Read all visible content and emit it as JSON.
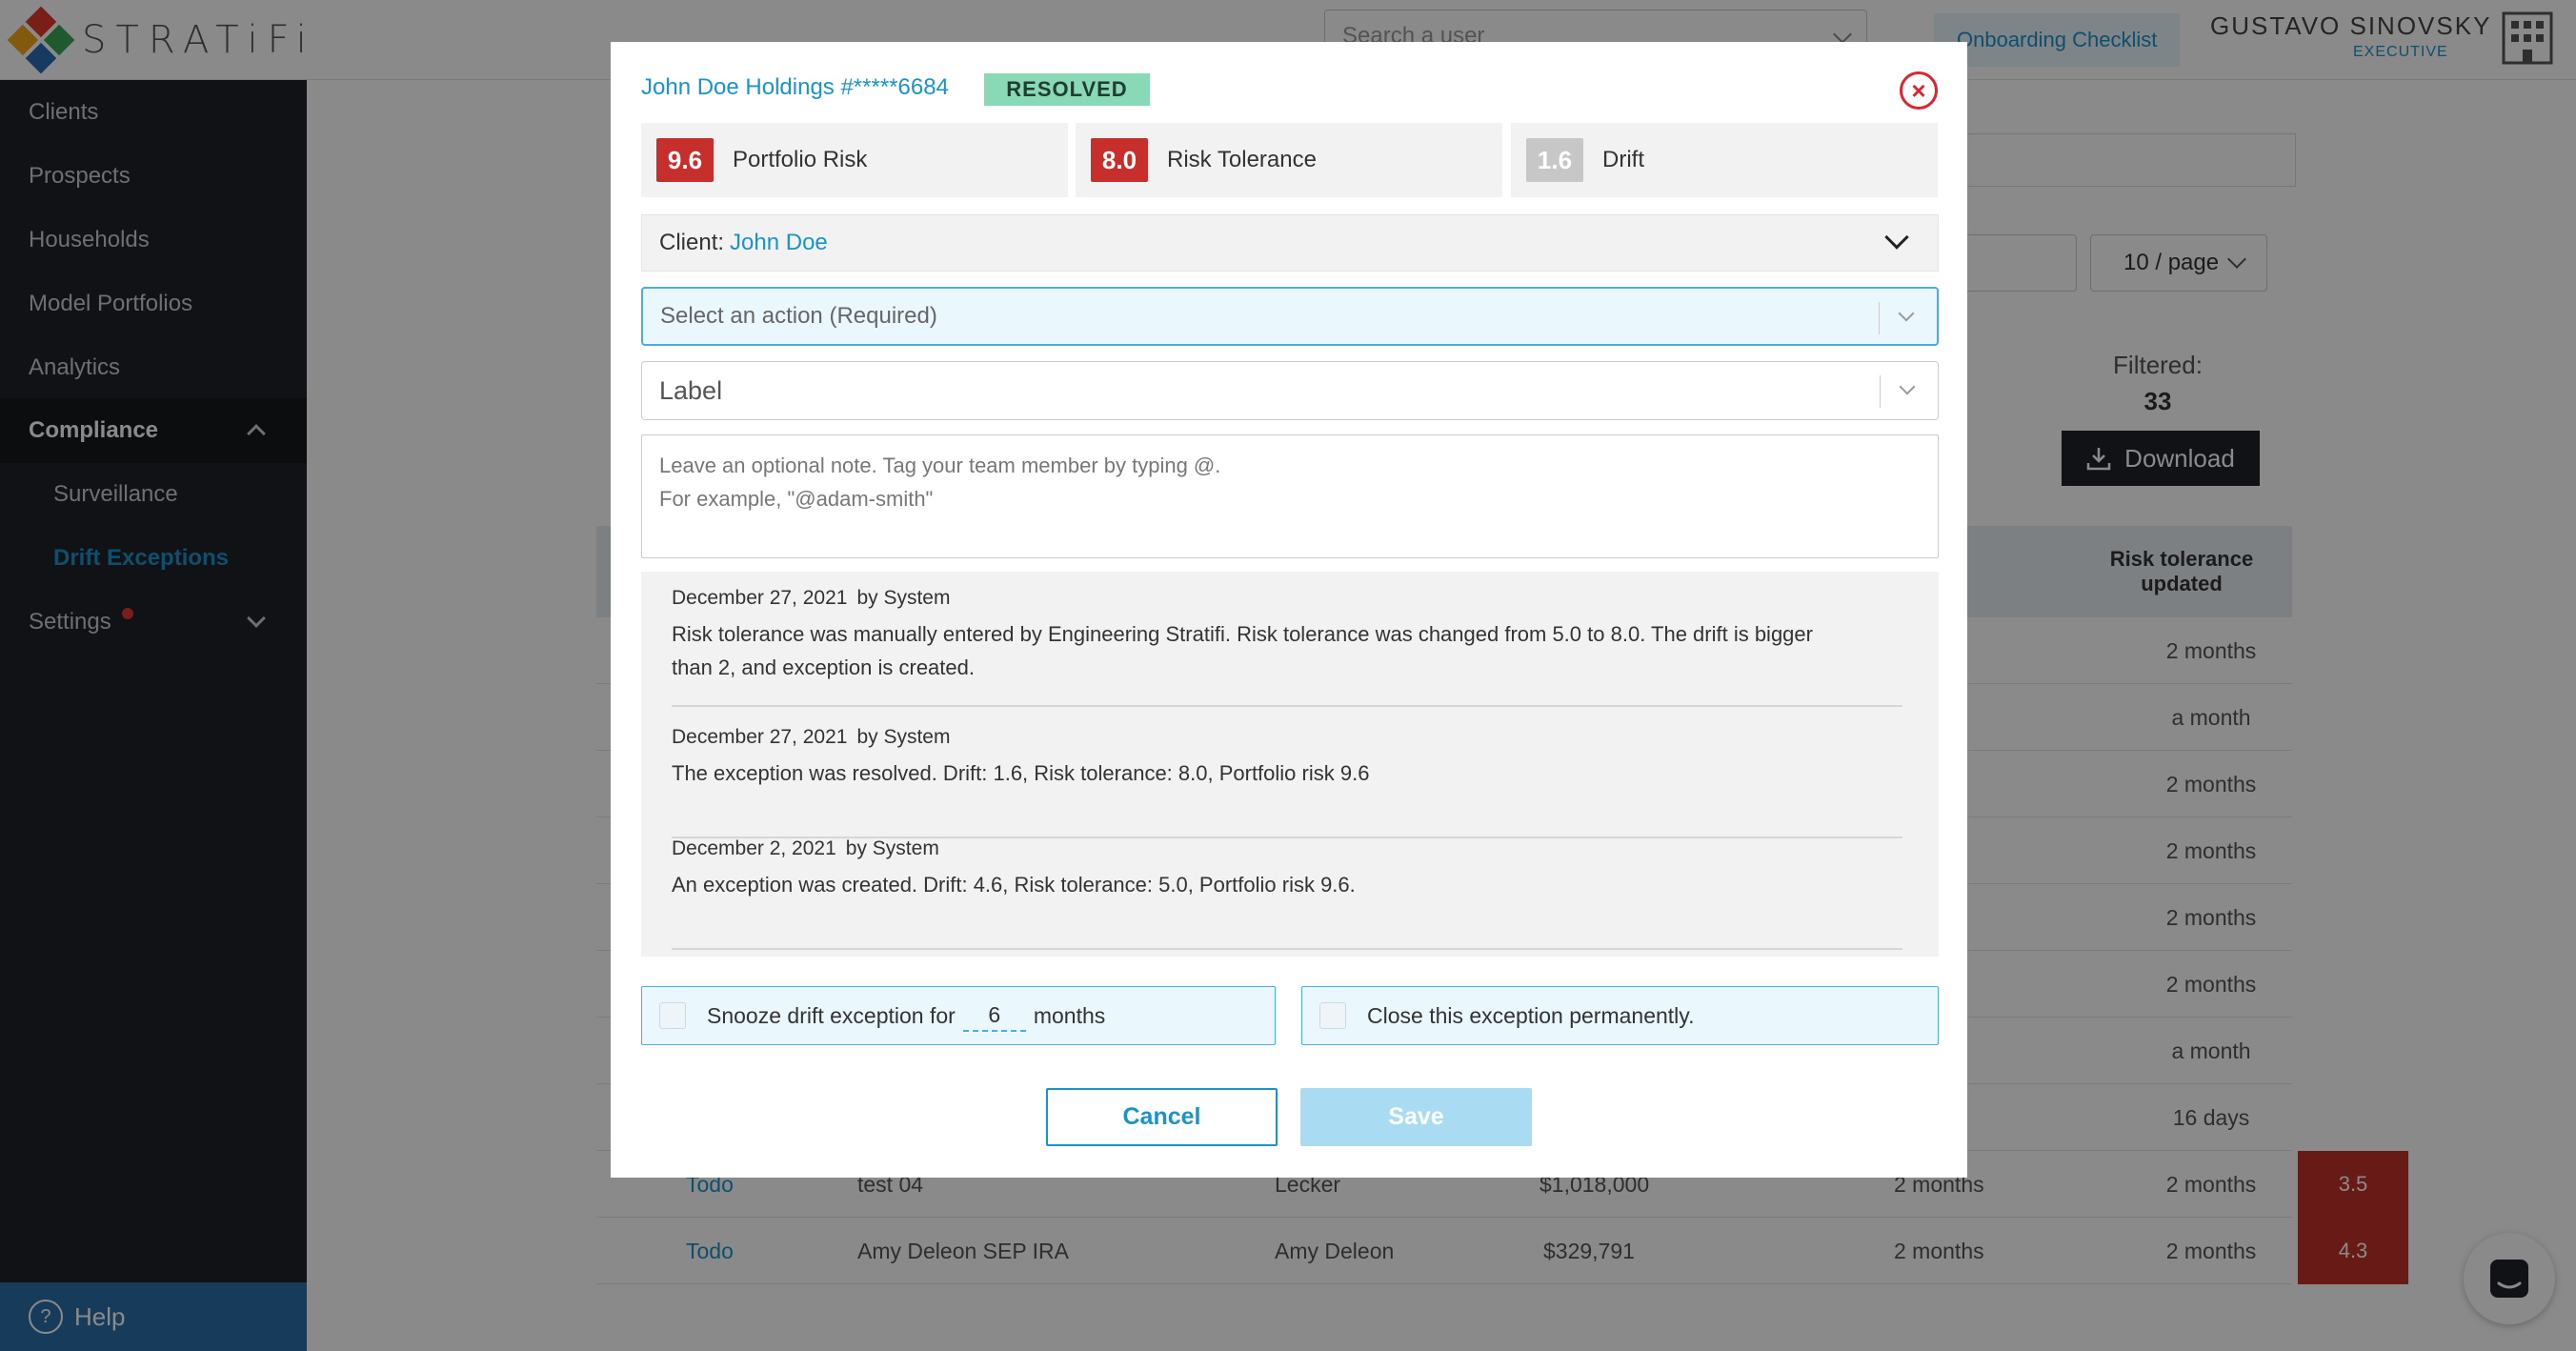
{
  "app": {
    "logo_text": "STRATiFi",
    "search_placeholder": "Search a user",
    "onboarding_label": "Onboarding Checklist",
    "user_name": "GUSTAVO SINOVSKY",
    "user_role": "EXECUTIVE"
  },
  "sidebar": {
    "items": [
      {
        "label": "Clients"
      },
      {
        "label": "Prospects"
      },
      {
        "label": "Households"
      },
      {
        "label": "Model Portfolios"
      },
      {
        "label": "Analytics"
      },
      {
        "label": "Compliance"
      },
      {
        "label": "Surveillance"
      },
      {
        "label": "Drift Exceptions"
      },
      {
        "label": "Settings"
      }
    ],
    "help_label": "Help"
  },
  "background": {
    "page_size": "10 / page",
    "filtered_label": "Filtered:",
    "filtered_count": "33",
    "download_label": "Download",
    "risk_tolerance_header": "Risk tolerance updated",
    "rows": [
      {
        "risk_updated": "2 months"
      },
      {
        "risk_updated": "a month"
      },
      {
        "risk_updated": "2 months"
      },
      {
        "risk_updated": "2 months"
      },
      {
        "risk_updated": "2 months"
      },
      {
        "risk_updated": "2 months"
      },
      {
        "risk_updated": "a month"
      },
      {
        "risk_updated": "16 days"
      },
      {
        "status": "Todo",
        "account": "test 04",
        "client": "Lecker",
        "value": "$1,018,000",
        "risk": "3.5",
        "drift_updated": "2 months",
        "risk_updated": "2 months"
      },
      {
        "status": "Todo",
        "account": "Amy Deleon SEP IRA",
        "client": "Amy Deleon",
        "value": "$329,791",
        "risk": "4.3",
        "drift_updated": "2 months",
        "risk_updated": "2 months"
      }
    ]
  },
  "modal": {
    "title": "John Doe Holdings #*****6684",
    "status": "RESOLVED",
    "metrics": [
      {
        "value": "9.6",
        "label": "Portfolio Risk",
        "color": "#c62f2c"
      },
      {
        "value": "8.0",
        "label": "Risk Tolerance",
        "color": "#c62f2c"
      },
      {
        "value": "1.6",
        "label": "Drift",
        "color": "#c7c7c7"
      }
    ],
    "client_label": "Client:",
    "client_name": "John Doe",
    "action_placeholder": "Select an action (Required)",
    "label_placeholder": "Label",
    "note_placeholder": "Leave an optional note. Tag your team member by typing @.\nFor example, \"@adam-smith\"",
    "history": [
      {
        "date": "December 27, 2021",
        "by": "by System",
        "text": "Risk tolerance was manually entered by Engineering Stratifi. Risk tolerance was changed from 5.0 to 8.0. The drift is bigger than 2, and exception is created."
      },
      {
        "date": "December 27, 2021",
        "by": "by System",
        "text": "The exception was resolved. Drift: 1.6, Risk tolerance: 8.0, Portfolio risk 9.6"
      },
      {
        "date": "December 2, 2021",
        "by": "by System",
        "text": "An exception was created. Drift: 4.6, Risk tolerance: 5.0, Portfolio risk 9.6."
      }
    ],
    "snooze_prefix": "Snooze drift exception for",
    "snooze_months": "6",
    "snooze_suffix": "months",
    "close_label": "Close this exception permanently.",
    "cancel_label": "Cancel",
    "save_label": "Save"
  }
}
